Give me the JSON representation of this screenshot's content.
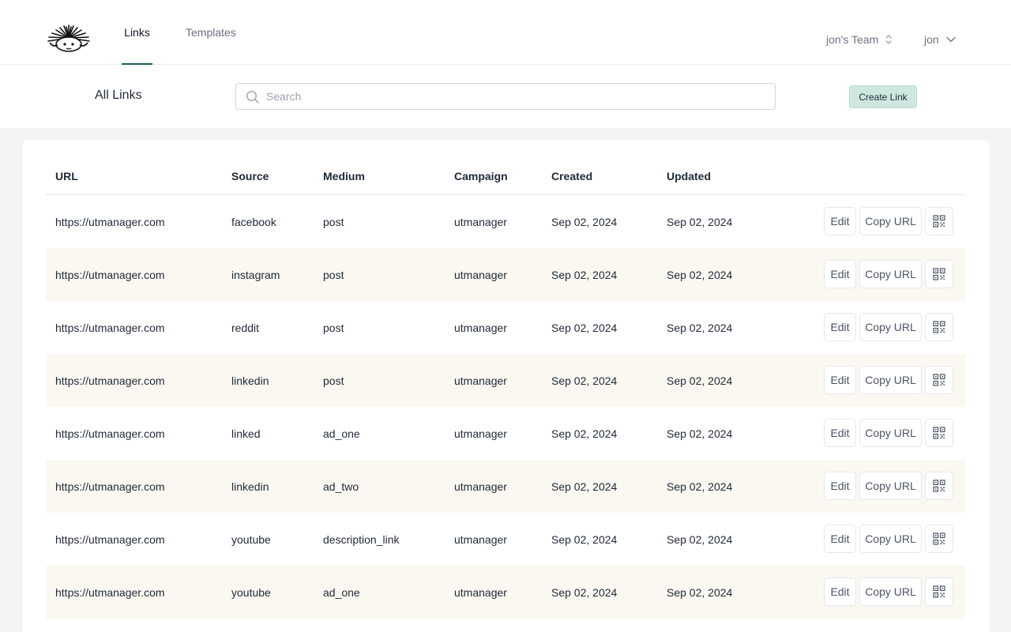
{
  "nav": {
    "tabs": [
      {
        "label": "Links",
        "active": true
      },
      {
        "label": "Templates",
        "active": false
      }
    ],
    "team": "jon's Team",
    "user": "jon"
  },
  "toolbar": {
    "title": "All Links",
    "search_placeholder": "Search",
    "search_value": "",
    "create_label": "Create Link"
  },
  "table": {
    "headers": [
      "URL",
      "Source",
      "Medium",
      "Campaign",
      "Created",
      "Updated"
    ],
    "actions": {
      "edit": "Edit",
      "copy": "Copy URL"
    },
    "rows": [
      {
        "url": "https://utmanager.com",
        "source": "facebook",
        "medium": "post",
        "campaign": "utmanager",
        "created": "Sep 02, 2024",
        "updated": "Sep 02, 2024"
      },
      {
        "url": "https://utmanager.com",
        "source": "instagram",
        "medium": "post",
        "campaign": "utmanager",
        "created": "Sep 02, 2024",
        "updated": "Sep 02, 2024"
      },
      {
        "url": "https://utmanager.com",
        "source": "reddit",
        "medium": "post",
        "campaign": "utmanager",
        "created": "Sep 02, 2024",
        "updated": "Sep 02, 2024"
      },
      {
        "url": "https://utmanager.com",
        "source": "linkedin",
        "medium": "post",
        "campaign": "utmanager",
        "created": "Sep 02, 2024",
        "updated": "Sep 02, 2024"
      },
      {
        "url": "https://utmanager.com",
        "source": "linked",
        "medium": "ad_one",
        "campaign": "utmanager",
        "created": "Sep 02, 2024",
        "updated": "Sep 02, 2024"
      },
      {
        "url": "https://utmanager.com",
        "source": "linkedin",
        "medium": "ad_two",
        "campaign": "utmanager",
        "created": "Sep 02, 2024",
        "updated": "Sep 02, 2024"
      },
      {
        "url": "https://utmanager.com",
        "source": "youtube",
        "medium": "description_link",
        "campaign": "utmanager",
        "created": "Sep 02, 2024",
        "updated": "Sep 02, 2024"
      },
      {
        "url": "https://utmanager.com",
        "source": "youtube",
        "medium": "ad_one",
        "campaign": "utmanager",
        "created": "Sep 02, 2024",
        "updated": "Sep 02, 2024"
      }
    ]
  },
  "colors": {
    "accent": "#1f5c5a",
    "button": "#cfe8df",
    "row_alt": "#faf8f1",
    "page_bg": "#f3f4f6"
  },
  "icons": [
    "hedgehog-logo",
    "search-icon",
    "updown-chevron-icon",
    "chevron-down-icon",
    "qr-code-icon"
  ]
}
